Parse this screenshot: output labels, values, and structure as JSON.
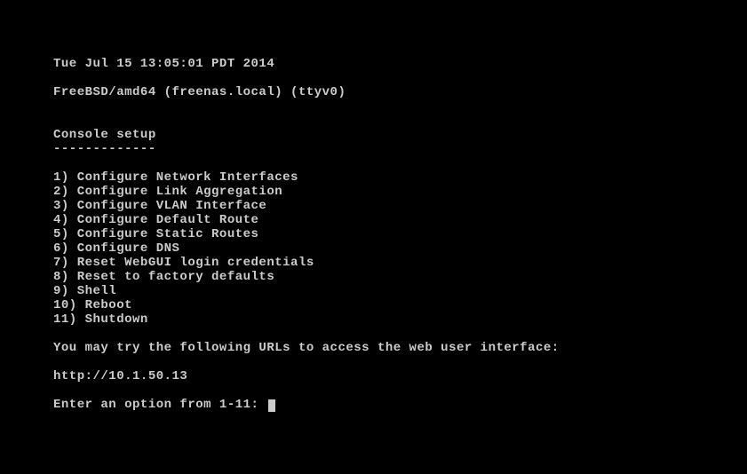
{
  "timestamp": "Tue Jul 15 13:05:01 PDT 2014",
  "system_line": "FreeBSD/amd64 (freenas.local) (ttyv0)",
  "section_title": "Console setup",
  "section_divider": "-------------",
  "menu": [
    {
      "num": "1",
      "label": "Configure Network Interfaces"
    },
    {
      "num": "2",
      "label": "Configure Link Aggregation"
    },
    {
      "num": "3",
      "label": "Configure VLAN Interface"
    },
    {
      "num": "4",
      "label": "Configure Default Route"
    },
    {
      "num": "5",
      "label": "Configure Static Routes"
    },
    {
      "num": "6",
      "label": "Configure DNS"
    },
    {
      "num": "7",
      "label": "Reset WebGUI login credentials"
    },
    {
      "num": "8",
      "label": "Reset to factory defaults"
    },
    {
      "num": "9",
      "label": "Shell"
    },
    {
      "num": "10",
      "label": "Reboot"
    },
    {
      "num": "11",
      "label": "Shutdown"
    }
  ],
  "url_intro": "You may try the following URLs to access the web user interface:",
  "url": "http://10.1.50.13",
  "prompt": "Enter an option from 1-11: "
}
